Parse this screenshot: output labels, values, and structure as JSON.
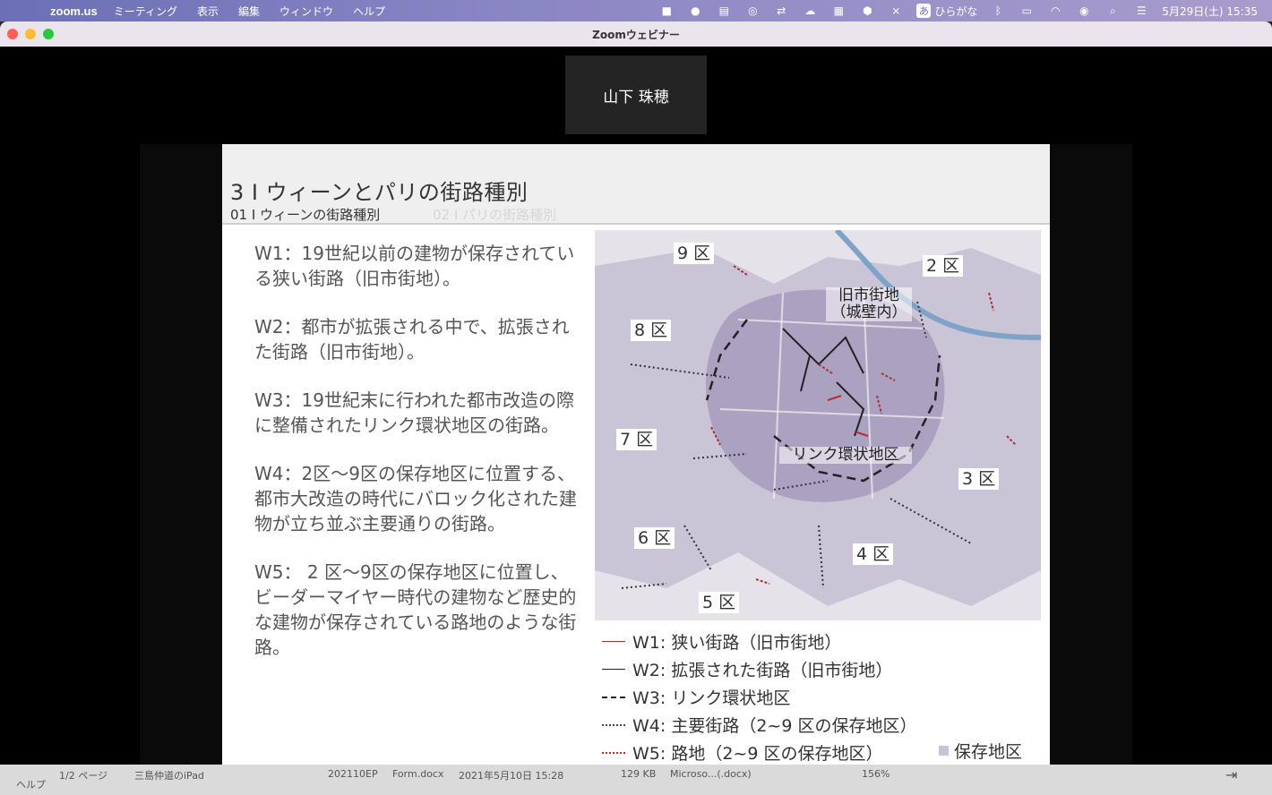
{
  "menubar": {
    "apple_icon": "apple-logo",
    "app_name": "zoom.us",
    "menus": [
      "ミーティング",
      "表示",
      "編集",
      "ウィンドウ",
      "ヘルプ"
    ],
    "ime_label": "あ",
    "ime_text": "ひらがな",
    "clock": "5月29日(土)  15:35"
  },
  "window": {
    "title": "Zoomウェビナー",
    "speaker_name": "山下 珠穂"
  },
  "slide": {
    "title": "3 I ウィーンとパリの街路種別",
    "sub_active": "01 I ウィーンの街路種別",
    "sub_inactive": "02 I パリの街路種別",
    "paragraphs": [
      "W1：19世紀以前の建物が保存されている狭い街路（旧市街地）。",
      "W2：都市が拡張される中で、拡張された街路（旧市街地）。",
      "W3：19世紀末に行われた都市改造の際に整備されたリンク環状地区の街路。",
      "W4：2区〜9区の保存地区に位置する、都市大改造の時代にバロック化された建物が立ち並ぶ主要通りの街路。",
      "W5： 2 区〜9区の保存地区に位置し、ビーダーマイヤー時代の建物など歴史的な建物が保存されている路地のような街路。"
    ],
    "map_labels": {
      "d9": "9 区",
      "d2": "2 区",
      "d8": "8 区",
      "d7": "7 区",
      "d3": "3 区",
      "d6": "6 区",
      "d4": "4 区",
      "d5": "5 区",
      "old_town_1": "旧市街地",
      "old_town_2": "（城壁内）",
      "ring": "リンク環状地区"
    },
    "legend": {
      "w1": "W1: 狭い街路（旧市街地）",
      "w2": "W2: 拡張された街路（旧市街地）",
      "w3": "W3: リンク環状地区",
      "w4": "W4: 主要街路（2~9 区の保存地区）",
      "w5": "W5: 路地（2~9 区の保存地区）",
      "conservation": "保存地区"
    }
  },
  "background": {
    "help": "ヘルプ",
    "page": "1/2 ページ",
    "device": "三島仲道のiPad",
    "filename": "202110EP",
    "filename2": "Form.docx",
    "date": "2021年5月10日 15:28",
    "size": "129 KB",
    "kind": "Microso...(.docx)",
    "zoom": "156%"
  },
  "colors": {
    "menubar": "#7a7abf",
    "w1_line": "#b03030",
    "conservation_area": "#c7c3d8"
  }
}
